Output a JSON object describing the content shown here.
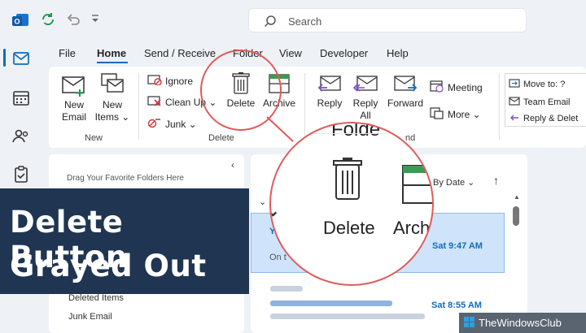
{
  "search": {
    "placeholder": "Search"
  },
  "menu": {
    "tabs": [
      "File",
      "Home",
      "Send / Receive",
      "Folder",
      "View",
      "Developer",
      "Help"
    ]
  },
  "ribbon": {
    "new_email": [
      "New",
      "Email"
    ],
    "new_items": [
      "New",
      "Items ⌄"
    ],
    "new_group": "New",
    "ignore": "Ignore",
    "clean_up": "Clean Up ⌄",
    "junk": "Junk ⌄",
    "delete": "Delete",
    "archive": "Archive",
    "delete_group": "Delete",
    "reply": "Reply",
    "reply_all": [
      "Reply",
      "All"
    ],
    "forward": "Forward",
    "meeting": "Meeting",
    "more": "More ⌄",
    "respond_group": "nd",
    "move_to": "Move to: ?",
    "team_email": "Team Email",
    "reply_delete": "Reply & Delet"
  },
  "folder_pane": {
    "drag_hint": "Drag Your Favorite Folders Here",
    "items": [
      "Deleted Items",
      "Junk Email"
    ]
  },
  "message_list": {
    "sort": "By Date ⌄",
    "selected_time": "Sat 9:47 AM",
    "second_time": "Sat 8:55 AM",
    "preview_a": "Yo",
    "preview_b": "On t"
  },
  "magnifier": {
    "folder_fragment": "Folde",
    "delete_label": "Delete",
    "archive_label": "Arch"
  },
  "banner": {
    "line1": "Delete Button",
    "line2": "Grayed Out"
  },
  "watermark": {
    "text": "TheWindowsClub"
  },
  "colors": {
    "accent": "#0f6cbd",
    "circle": "#e05a5a",
    "banner": "#1f3552"
  }
}
